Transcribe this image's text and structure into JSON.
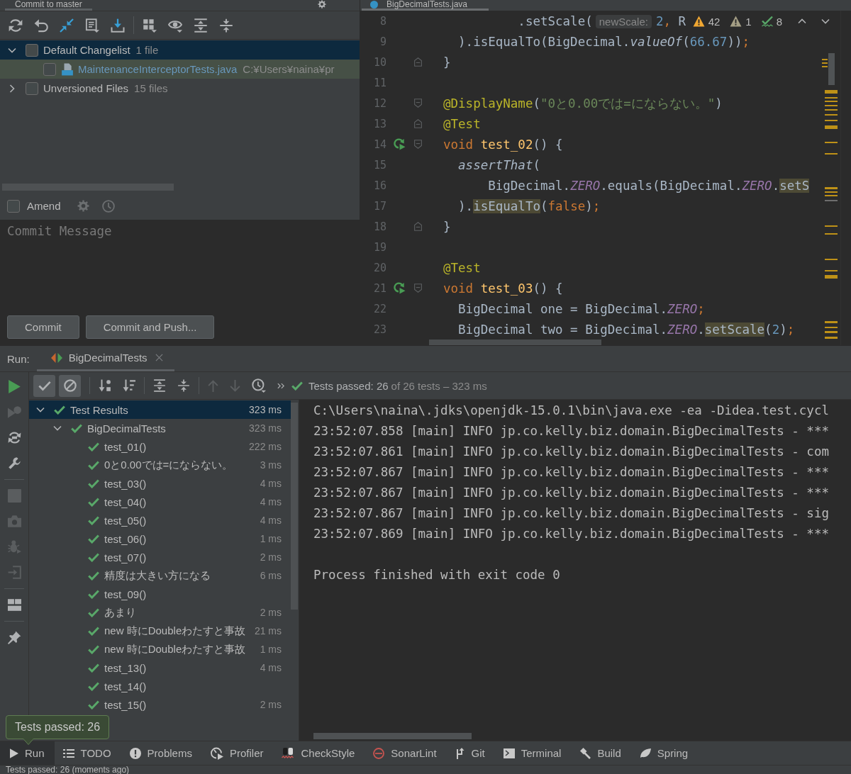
{
  "commit_panel": {
    "title": "Commit to master",
    "toolbar": [
      {
        "kind": "refresh"
      },
      {
        "kind": "rollback"
      },
      {
        "kind": "diff"
      },
      {
        "kind": "changelist"
      },
      {
        "kind": "update"
      },
      {
        "kind": "separator"
      },
      {
        "kind": "group"
      },
      {
        "kind": "view"
      },
      {
        "kind": "expand"
      },
      {
        "kind": "collapse"
      }
    ],
    "tree": [
      {
        "kind": "changelist",
        "label": "Default Changelist",
        "count": "1 file",
        "expanded": true,
        "checked": false,
        "selected": true,
        "highlighted": false,
        "children": [
          {
            "kind": "modified_file",
            "label": "MaintenanceInterceptorTests.java",
            "path": "C:¥Users¥naina¥pr",
            "checked": false,
            "selected": false,
            "highlighted": true
          }
        ]
      },
      {
        "kind": "changelist",
        "label": "Unversioned Files",
        "count": "15 files",
        "expanded": false,
        "checked": false,
        "selected": false,
        "highlighted": false
      }
    ],
    "amend": {
      "label": "Amend",
      "checked": false
    },
    "message": {
      "placeholder": "Commit Message"
    },
    "buttons": [
      "Commit",
      "Commit and Push..."
    ]
  },
  "editor": {
    "tab": "BigDecimalTests.java",
    "inspections": [
      {
        "kind": "warning",
        "count": "42"
      },
      {
        "kind": "weak_warning",
        "count": "1"
      },
      {
        "kind": "typo",
        "count": "8"
      }
    ],
    "lines": [
      {
        "number": "8",
        "tokens": [
          {
            "text": "          .setScale(",
            "kind": "plain",
            "highlight": false
          },
          {
            "text": "newScale:",
            "kind": "hint",
            "highlight": false
          },
          {
            "text": "2",
            "kind": "number",
            "highlight": false
          },
          {
            "text": ",",
            "kind": "punct",
            "highlight": false
          },
          {
            "text": " R",
            "kind": "plain",
            "highlight": false
          }
        ]
      },
      {
        "number": "9",
        "tokens": [
          {
            "text": "  ).isEqualTo(BigDecimal.",
            "kind": "plain",
            "highlight": false
          },
          {
            "text": "valueOf",
            "kind": "italic",
            "highlight": false
          },
          {
            "text": "(",
            "kind": "plain",
            "highlight": false
          },
          {
            "text": "66.67",
            "kind": "number",
            "highlight": false
          },
          {
            "text": "))",
            "kind": "plain",
            "highlight": false
          },
          {
            "text": ";",
            "kind": "punct",
            "highlight": false
          }
        ]
      },
      {
        "number": "10",
        "markers": [
          {
            "kind": "fold_end"
          }
        ],
        "tokens": [
          {
            "text": "}",
            "kind": "plain",
            "highlight": false
          }
        ]
      },
      {
        "number": "11"
      },
      {
        "number": "12",
        "markers": [
          {
            "kind": "fold_start"
          }
        ],
        "tokens": [
          {
            "text": "@DisplayName",
            "kind": "annotation",
            "highlight": false
          },
          {
            "text": "(",
            "kind": "plain",
            "highlight": false
          },
          {
            "text": "\"0と0.00では=にならない。\"",
            "kind": "string",
            "highlight": false
          },
          {
            "text": ")",
            "kind": "plain",
            "highlight": false
          }
        ]
      },
      {
        "number": "13",
        "markers": [
          {
            "kind": "fold_end"
          }
        ],
        "tokens": [
          {
            "text": "@Test",
            "kind": "annotation",
            "highlight": false
          }
        ]
      },
      {
        "number": "14",
        "markers": [
          {
            "kind": "run"
          },
          {
            "kind": "fold_start"
          }
        ],
        "tokens": [
          {
            "text": "void ",
            "kind": "keyword",
            "highlight": false
          },
          {
            "text": "test_02",
            "kind": "decl",
            "highlight": false
          },
          {
            "text": "() {",
            "kind": "plain",
            "highlight": false
          }
        ]
      },
      {
        "number": "15",
        "tokens": [
          {
            "text": "  assertThat",
            "kind": "italic",
            "highlight": false
          },
          {
            "text": "(",
            "kind": "plain",
            "highlight": false
          }
        ]
      },
      {
        "number": "16",
        "tokens": [
          {
            "text": "      BigDecimal.",
            "kind": "plain",
            "highlight": false
          },
          {
            "text": "ZERO",
            "kind": "static",
            "highlight": false
          },
          {
            "text": ".equals(BigDecimal.",
            "kind": "plain",
            "highlight": false
          },
          {
            "text": "ZERO",
            "kind": "static",
            "highlight": false
          },
          {
            "text": ".",
            "kind": "plain",
            "highlight": false
          },
          {
            "text": "setS",
            "kind": "plain",
            "highlight": true
          }
        ]
      },
      {
        "number": "17",
        "tokens": [
          {
            "text": "  ).",
            "kind": "plain",
            "highlight": false
          },
          {
            "text": "isEqualTo",
            "kind": "plain",
            "highlight": true
          },
          {
            "text": "(",
            "kind": "plain",
            "highlight": false
          },
          {
            "text": "false",
            "kind": "keyword",
            "highlight": false
          },
          {
            "text": ")",
            "kind": "plain",
            "highlight": false
          },
          {
            "text": ";",
            "kind": "punct",
            "highlight": false
          }
        ]
      },
      {
        "number": "18",
        "markers": [
          {
            "kind": "fold_end"
          }
        ],
        "tokens": [
          {
            "text": "}",
            "kind": "plain",
            "highlight": false
          }
        ]
      },
      {
        "number": "19"
      },
      {
        "number": "20",
        "tokens": [
          {
            "text": "@Test",
            "kind": "annotation",
            "highlight": false
          }
        ]
      },
      {
        "number": "21",
        "markers": [
          {
            "kind": "run"
          },
          {
            "kind": "fold_start"
          }
        ],
        "tokens": [
          {
            "text": "void ",
            "kind": "keyword",
            "highlight": false
          },
          {
            "text": "test_03",
            "kind": "decl",
            "highlight": false
          },
          {
            "text": "() {",
            "kind": "plain",
            "highlight": false
          }
        ]
      },
      {
        "number": "22",
        "tokens": [
          {
            "text": "  BigDecimal one = BigDecimal.",
            "kind": "plain",
            "highlight": false
          },
          {
            "text": "ZERO",
            "kind": "static",
            "highlight": false
          },
          {
            "text": ";",
            "kind": "punct",
            "highlight": false
          }
        ]
      },
      {
        "number": "23",
        "tokens": [
          {
            "text": "  BigDecimal two = BigDecimal.",
            "kind": "plain",
            "highlight": false
          },
          {
            "text": "ZERO",
            "kind": "static",
            "highlight": false
          },
          {
            "text": ".",
            "kind": "plain",
            "highlight": false
          },
          {
            "text": "setScale",
            "kind": "plain",
            "highlight": true
          },
          {
            "text": "(",
            "kind": "plain",
            "highlight": false
          },
          {
            "text": "2",
            "kind": "number",
            "highlight": false
          },
          {
            "text": ")",
            "kind": "plain",
            "highlight": false
          },
          {
            "text": ";",
            "kind": "punct",
            "highlight": false
          }
        ]
      }
    ]
  },
  "run_panel": {
    "label": "Run:",
    "tab": {
      "title": "BigDecimalTests",
      "selected": true
    },
    "side_toolbar": [
      {
        "kind": "rerun",
        "disabled": false
      },
      {
        "kind": "rerun_failed",
        "disabled": true
      },
      {
        "kind": "auto_test",
        "disabled": false
      },
      {
        "kind": "settings",
        "disabled": false
      },
      {
        "kind": "separator"
      },
      {
        "kind": "stop",
        "disabled": true
      },
      {
        "kind": "snapshot",
        "disabled": true
      },
      {
        "kind": "debug",
        "disabled": true
      },
      {
        "kind": "exit",
        "disabled": true
      },
      {
        "kind": "separator"
      },
      {
        "kind": "layout",
        "disabled": false
      },
      {
        "kind": "separator"
      },
      {
        "kind": "pin",
        "disabled": false
      }
    ],
    "toolbar": [
      {
        "kind": "show_passed",
        "selected": true
      },
      {
        "kind": "show_ignored",
        "selected": true
      },
      {
        "kind": "separator"
      },
      {
        "kind": "sort_alpha",
        "disabled": false
      },
      {
        "kind": "sort_duration",
        "disabled": false
      },
      {
        "kind": "separator"
      },
      {
        "kind": "expand",
        "disabled": false
      },
      {
        "kind": "collapse",
        "disabled": false
      },
      {
        "kind": "separator"
      },
      {
        "kind": "previous",
        "disabled": true
      },
      {
        "kind": "next",
        "disabled": true
      },
      {
        "kind": "history",
        "disabled": false
      },
      {
        "kind": "more",
        "disabled": false
      }
    ],
    "summary": {
      "passed": true,
      "text": "Tests passed: 26",
      "detail": "of 26 tests – 323 ms"
    },
    "test_tree": [
      {
        "label": "Test Results",
        "time": "323 ms",
        "passed": true,
        "expanded": true,
        "selected": true,
        "children": [
          {
            "label": "BigDecimalTests",
            "time": "323 ms",
            "passed": true,
            "expanded": true,
            "selected": false,
            "children": [
              {
                "label": "test_01()",
                "time": "222 ms",
                "passed": true,
                "selected": false
              },
              {
                "label": "0と0.00では=にならない。",
                "time": "3 ms",
                "passed": true,
                "selected": false
              },
              {
                "label": "test_03()",
                "time": "4 ms",
                "passed": true,
                "selected": false
              },
              {
                "label": "test_04()",
                "time": "4 ms",
                "passed": true,
                "selected": false
              },
              {
                "label": "test_05()",
                "time": "4 ms",
                "passed": true,
                "selected": false
              },
              {
                "label": "test_06()",
                "time": "1 ms",
                "passed": true,
                "selected": false
              },
              {
                "label": "test_07()",
                "time": "2 ms",
                "passed": true,
                "selected": false
              },
              {
                "label": "精度は大きい方になる",
                "time": "6 ms",
                "passed": true,
                "selected": false
              },
              {
                "label": "test_09()",
                "passed": true,
                "selected": false
              },
              {
                "label": "あまり",
                "time": "2 ms",
                "passed": true,
                "selected": false
              },
              {
                "label": "new 時にDoubleわたすと事故",
                "time": "21 ms",
                "passed": true,
                "selected": false
              },
              {
                "label": "new 時にDoubleわたすと事故",
                "time": "1 ms",
                "passed": true,
                "selected": false
              },
              {
                "label": "test_13()",
                "time": "4 ms",
                "passed": true,
                "selected": false
              },
              {
                "label": "test_14()",
                "passed": true,
                "selected": false
              },
              {
                "label": "test_15()",
                "time": "2 ms",
                "passed": true,
                "selected": false
              }
            ]
          }
        ]
      }
    ],
    "console": {
      "lines": [
        "C:\\Users\\naina\\.jdks\\openjdk-15.0.1\\bin\\java.exe -ea -Didea.test.cycl",
        "23:52:07.858 [main] INFO jp.co.kelly.biz.domain.BigDecimalTests - ***",
        "23:52:07.861 [main] INFO jp.co.kelly.biz.domain.BigDecimalTests - com",
        "23:52:07.867 [main] INFO jp.co.kelly.biz.domain.BigDecimalTests - ***",
        "23:52:07.867 [main] INFO jp.co.kelly.biz.domain.BigDecimalTests - ***",
        "23:52:07.867 [main] INFO jp.co.kelly.biz.domain.BigDecimalTests - sig",
        "23:52:07.869 [main] INFO jp.co.kelly.biz.domain.BigDecimalTests - ***"
      ],
      "exit_message": "Process finished with exit code 0"
    }
  },
  "tool_windows": [
    {
      "kind": "run",
      "label": "Run",
      "selected": true
    },
    {
      "kind": "todo",
      "label": "TODO",
      "selected": false
    },
    {
      "kind": "problems",
      "label": "Problems",
      "selected": false
    },
    {
      "kind": "profiler",
      "label": "Profiler",
      "selected": false
    },
    {
      "kind": "checkstyle",
      "label": "CheckStyle",
      "selected": false
    },
    {
      "kind": "sonarlint",
      "label": "SonarLint",
      "selected": false
    },
    {
      "kind": "git",
      "label": "Git",
      "selected": false
    },
    {
      "kind": "terminal",
      "label": "Terminal",
      "selected": false
    },
    {
      "kind": "build",
      "label": "Build",
      "selected": false
    },
    {
      "kind": "spring",
      "label": "Spring",
      "selected": false
    }
  ],
  "tooltip": {
    "text": "Tests passed: 26"
  },
  "status_bar": {
    "text": "Tests passed: 26 (moments ago)"
  }
}
